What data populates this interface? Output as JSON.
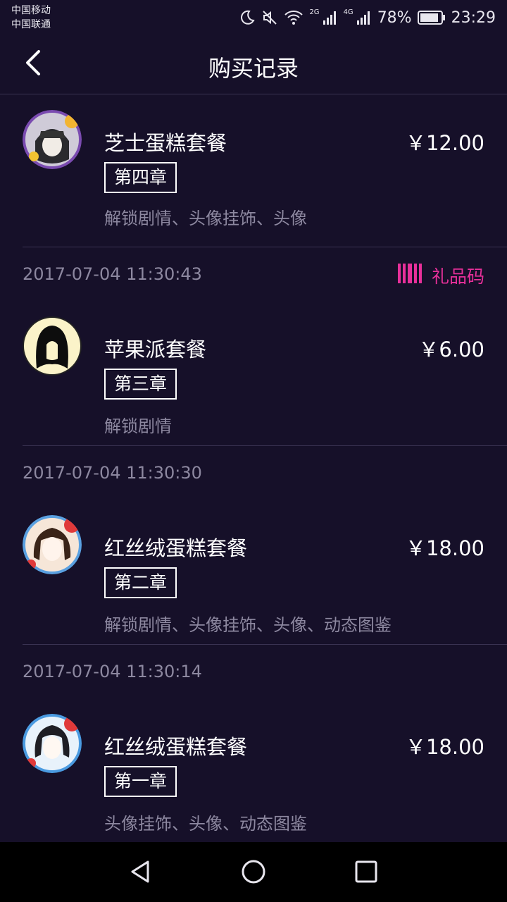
{
  "status_bar": {
    "carrier1": "中国移动",
    "carrier2": "中国联通",
    "sig1_label": "2G",
    "sig2_label": "4G",
    "battery": "78%",
    "time": "23:29"
  },
  "header": {
    "title": "购买记录"
  },
  "records": [
    {
      "timestamp": "",
      "gift_code": "",
      "name": "芝士蛋糕套餐",
      "price": "￥12.00",
      "chapter": "第四章",
      "unlocks": "解锁剧情、头像挂饰、头像",
      "avatar_icon": "cheesecake-avatar"
    },
    {
      "timestamp": "2017-07-04 11:30:43",
      "gift_code": "礼品码",
      "name": "苹果派套餐",
      "price": "￥6.00",
      "chapter": "第三章",
      "unlocks": "解锁剧情",
      "avatar_icon": "applepie-avatar"
    },
    {
      "timestamp": "2017-07-04 11:30:30",
      "gift_code": "",
      "name": "红丝绒蛋糕套餐",
      "price": "￥18.00",
      "chapter": "第二章",
      "unlocks": "解锁剧情、头像挂饰、头像、动态图鉴",
      "avatar_icon": "redvelvet-avatar"
    },
    {
      "timestamp": "2017-07-04 11:30:14",
      "gift_code": "",
      "name": "红丝绒蛋糕套餐",
      "price": "￥18.00",
      "chapter": "第一章",
      "unlocks": "头像挂饰、头像、动态图鉴",
      "avatar_icon": "redvelvet-avatar"
    }
  ],
  "colors": {
    "background": "#161029",
    "accent": "#e8309a",
    "muted_text": "#8d88a0"
  }
}
